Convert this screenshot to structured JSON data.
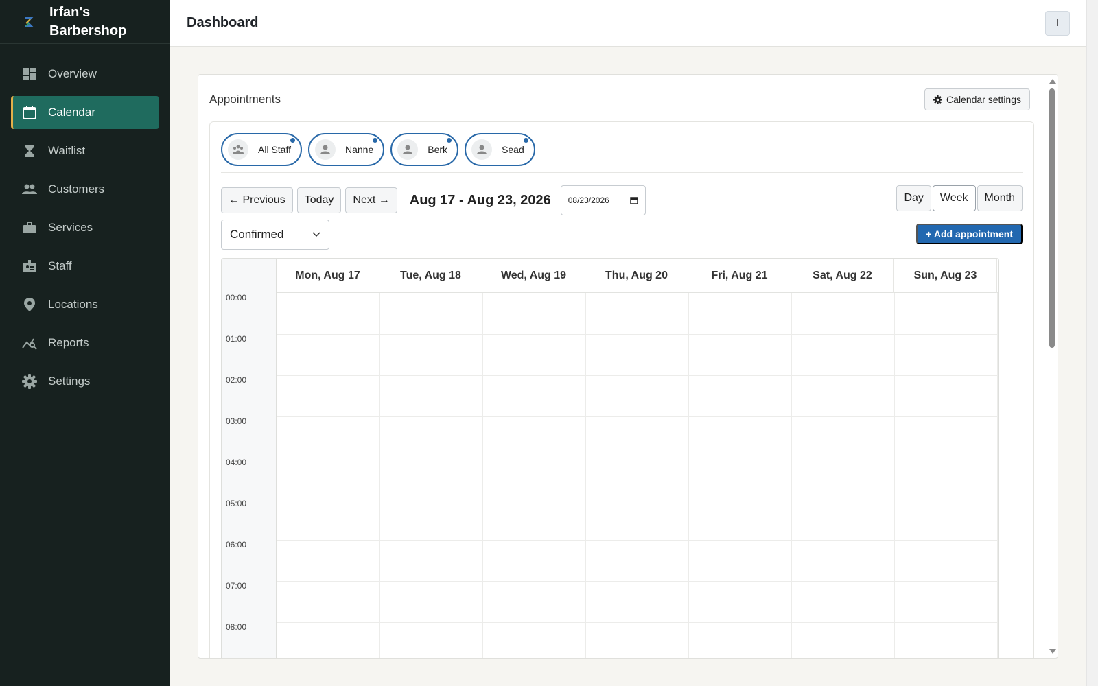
{
  "brand": {
    "name": "Irfan's Barbershop"
  },
  "sidebar": {
    "items": [
      {
        "label": "Overview",
        "icon": "dashboard-icon",
        "active": false
      },
      {
        "label": "Calendar",
        "icon": "calendar-icon",
        "active": true
      },
      {
        "label": "Waitlist",
        "icon": "hourglass-icon",
        "active": false
      },
      {
        "label": "Customers",
        "icon": "users-icon",
        "active": false
      },
      {
        "label": "Services",
        "icon": "briefcase-icon",
        "active": false
      },
      {
        "label": "Staff",
        "icon": "id-badge-icon",
        "active": false
      },
      {
        "label": "Locations",
        "icon": "location-pin-icon",
        "active": false
      },
      {
        "label": "Reports",
        "icon": "chart-line-icon",
        "active": false
      },
      {
        "label": "Settings",
        "icon": "gear-icon",
        "active": false
      }
    ]
  },
  "header": {
    "title": "Dashboard",
    "avatar_initial": "I"
  },
  "card": {
    "title": "Appointments",
    "settings_label": "Calendar settings"
  },
  "staff": [
    {
      "name": "All Staff",
      "icon": "group-icon"
    },
    {
      "name": "Nanne",
      "icon": "person-icon"
    },
    {
      "name": "Berk",
      "icon": "person-icon"
    },
    {
      "name": "Sead",
      "icon": "person-icon"
    }
  ],
  "controls": {
    "previous": "← Previous",
    "today": "Today",
    "next": "Next →",
    "range": "Aug 17 - Aug 23, 2026",
    "date_value": "08/23/2026",
    "views": [
      "Day",
      "Week",
      "Month"
    ],
    "active_view": "Week",
    "status_value": "Confirmed",
    "add_label": "+ Add appointment"
  },
  "week": {
    "days": [
      "Mon, Aug 17",
      "Tue, Aug 18",
      "Wed, Aug 19",
      "Thu, Aug 20",
      "Fri, Aug 21",
      "Sat, Aug 22",
      "Sun, Aug 23"
    ],
    "hours": [
      "00:00",
      "01:00",
      "02:00",
      "03:00",
      "04:00",
      "05:00",
      "06:00",
      "07:00",
      "08:00"
    ]
  },
  "colors": {
    "sidebar_bg": "#17211f",
    "active_nav": "#1f6b5e",
    "accent_blue": "#2268b0",
    "active_border": "#e2b04a"
  }
}
